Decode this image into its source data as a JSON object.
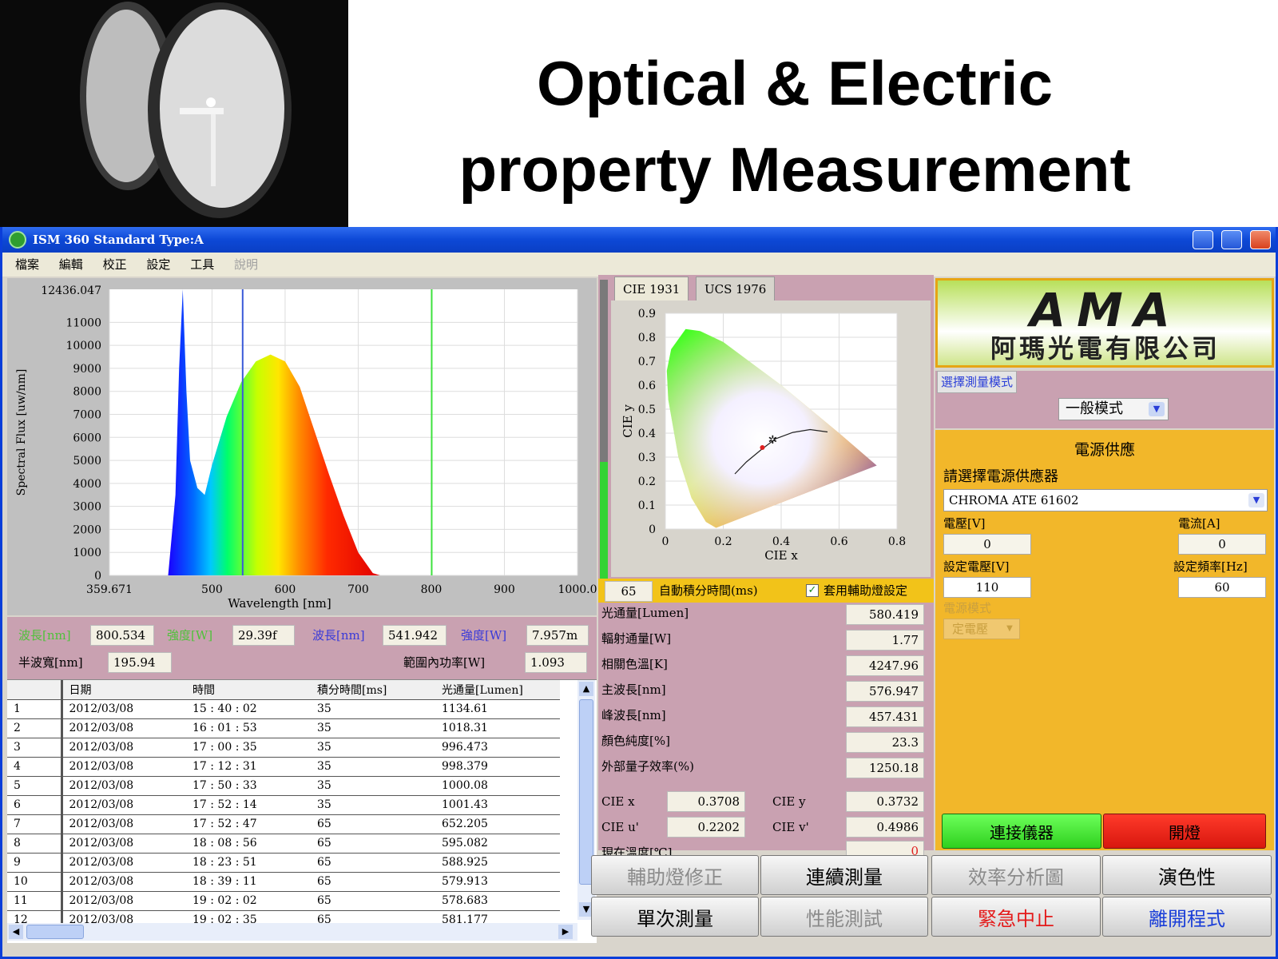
{
  "slide": {
    "title_line1": "Optical & Electric",
    "title_line2": "property Measurement"
  },
  "window": {
    "title": "ISM 360 Standard Type:A"
  },
  "menu": [
    "檔案",
    "編輯",
    "校正",
    "設定",
    "工具",
    "說明"
  ],
  "spectrum": {
    "y_max_label": "12436.047",
    "y_ticks": [
      "11000",
      "10000",
      "9000",
      "8000",
      "7000",
      "6000",
      "5000",
      "4000",
      "3000",
      "2000",
      "1000",
      "0"
    ],
    "x_ticks": [
      "359.671",
      "500",
      "600",
      "700",
      "800",
      "900",
      "1000.0"
    ],
    "xlabel": "Wavelength [nm]",
    "ylabel": "Spectral Flux [uw/nm]"
  },
  "chart_data": [
    {
      "type": "area",
      "xlabel": "Wavelength [nm]",
      "ylabel": "Spectral Flux [uw/nm]",
      "xlim": [
        359.671,
        1000
      ],
      "ylim": [
        0,
        12436.047
      ],
      "x": [
        440,
        450,
        455,
        460,
        465,
        470,
        480,
        490,
        500,
        520,
        540,
        560,
        580,
        600,
        620,
        640,
        660,
        680,
        700,
        720,
        730
      ],
      "y": [
        0,
        3500,
        9000,
        12436,
        8000,
        5000,
        3800,
        3500,
        4800,
        6900,
        8400,
        9300,
        9600,
        9300,
        8200,
        6300,
        4400,
        2600,
        1000,
        100,
        0
      ],
      "markers": [
        541.942,
        800.534
      ]
    },
    {
      "type": "scatter",
      "xlabel": "CIE x",
      "ylabel": "CIE y",
      "xlim": [
        0,
        0.8
      ],
      "ylim": [
        0,
        0.9
      ],
      "x": [
        0.3708
      ],
      "y": [
        0.3732
      ]
    }
  ],
  "readouts": {
    "wl_label1": "波長[nm]",
    "wl_val1": "800.534",
    "int_label1": "強度[W]",
    "int_val1": "29.39f",
    "wl_label2": "波長[nm]",
    "wl_val2": "541.942",
    "int_label2": "強度[W]",
    "int_val2": "7.957m",
    "hw_label": "半波寬[nm]",
    "hw_val": "195.94",
    "power_label": "範圍內功率[W]",
    "power_val": "1.093"
  },
  "table": {
    "headers": [
      "",
      "日期",
      "時間",
      "積分時間[ms]",
      "光通量[Lumen]"
    ],
    "rows": [
      [
        "1",
        "2012/03/08",
        "15 : 40 : 02",
        "35",
        "1134.61"
      ],
      [
        "2",
        "2012/03/08",
        "16 : 01 : 53",
        "35",
        "1018.31"
      ],
      [
        "3",
        "2012/03/08",
        "17 : 00 : 35",
        "35",
        "996.473"
      ],
      [
        "4",
        "2012/03/08",
        "17 : 12 : 31",
        "35",
        "998.379"
      ],
      [
        "5",
        "2012/03/08",
        "17 : 50 : 33",
        "35",
        "1000.08"
      ],
      [
        "6",
        "2012/03/08",
        "17 : 52 : 14",
        "35",
        "1001.43"
      ],
      [
        "7",
        "2012/03/08",
        "17 : 52 : 47",
        "65",
        "652.205"
      ],
      [
        "8",
        "2012/03/08",
        "18 : 08 : 56",
        "65",
        "595.082"
      ],
      [
        "9",
        "2012/03/08",
        "18 : 23 : 51",
        "65",
        "588.925"
      ],
      [
        "10",
        "2012/03/08",
        "18 : 39 : 11",
        "65",
        "579.913"
      ],
      [
        "11",
        "2012/03/08",
        "19 : 02 : 02",
        "65",
        "578.683"
      ],
      [
        "12",
        "2012/03/08",
        "19 : 02 : 35",
        "65",
        "581.177"
      ]
    ]
  },
  "cie": {
    "tab1": "CIE 1931",
    "tab2": "UCS 1976",
    "y_ticks": [
      "0.9",
      "0.8",
      "0.7",
      "0.6",
      "0.5",
      "0.4",
      "0.3",
      "0.2",
      "0.1",
      "0"
    ],
    "x_ticks": [
      "0",
      "0.2",
      "0.4",
      "0.6",
      "0.8"
    ],
    "xlabel": "CIE x",
    "ylabel": "CIE y",
    "level_fraction": 0.39
  },
  "auto": {
    "value": "65",
    "label": "自動積分時間(ms)",
    "check_label": "套用輔助燈設定",
    "checked": true
  },
  "measurements": [
    {
      "label": "光通量[Lumen]",
      "value": "580.419"
    },
    {
      "label": "輻射通量[W]",
      "value": "1.77"
    },
    {
      "label": "相關色溫[K]",
      "value": "4247.96"
    },
    {
      "label": "主波長[nm]",
      "value": "576.947"
    },
    {
      "label": "峰波長[nm]",
      "value": "457.431"
    },
    {
      "label": "顏色純度[%]",
      "value": "23.3"
    },
    {
      "label": "外部量子效率(%)",
      "value": "1250.18"
    }
  ],
  "cie_values": {
    "x_label": "CIE x",
    "x": "0.3708",
    "y_label": "CIE y",
    "y": "0.3732",
    "u_label": "CIE u'",
    "u": "0.2202",
    "v_label": "CIE v'",
    "v": "0.4986",
    "temp_label": "現在溫度[℃]",
    "temp": "0"
  },
  "logo": {
    "brand": "AMA",
    "company": "阿瑪光電有限公司"
  },
  "mode": {
    "title": "選擇測量模式",
    "value": "一般模式"
  },
  "power": {
    "title": "電源供應",
    "supplier_label": "請選擇電源供應器",
    "supplier": "CHROMA ATE 61602",
    "voltage_label": "電壓[V]",
    "voltage": "0",
    "current_label": "電流[A]",
    "current": "0",
    "set_voltage_label": "設定電壓[V]",
    "set_voltage": "110",
    "set_freq_label": "設定頻率[Hz]",
    "set_freq": "60",
    "mode_label": "電源模式",
    "mode_value": "定電壓"
  },
  "buttons": {
    "connect": "連接儀器",
    "light": "開燈",
    "aux": "輔助燈修正",
    "continuous": "連續測量",
    "efficiency": "效率分析圖",
    "color_render": "演色性",
    "single": "單次測量",
    "performance": "性能測試",
    "emergency": "緊急中止",
    "exit": "離開程式"
  },
  "colors": {
    "titlebar": "#0d48d6",
    "panel_pink": "#c9a1b1",
    "panel_gold": "#f2b72a",
    "connect": "#49e53a",
    "light": "#e8221a"
  }
}
